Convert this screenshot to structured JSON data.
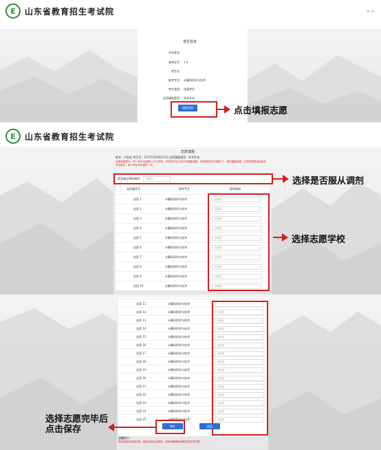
{
  "site_title": "山东省教育招生考试院",
  "header_right": "≡ ∨",
  "panel1": {
    "title": "考生信息",
    "fields": [
      {
        "label": "学生姓名：",
        "value": ""
      },
      {
        "label": "准考证号：",
        "value": "1                    9"
      },
      {
        "label": "考生号：",
        "value": ""
      },
      {
        "label": "报考专业：",
        "value": "计算机科学与技术"
      },
      {
        "label": "考生类型：",
        "value": "往届考生"
      },
      {
        "label": "志愿填报类型：",
        "value": "非专升本"
      }
    ],
    "fill_button": "填报志愿",
    "annotation": "点击填报志愿"
  },
  "panel2": {
    "title": "志愿填报",
    "info": "姓名：卢金宏    考生号：22371501822722    志愿填报类型：非专升本",
    "warning": "志愿填报提示：同一专业可选择1-20个学校，不同的专业之间不可重复填报，专科院校仅可填报1个，请勿重复填报，注意院校是否招收本专业考生，每个考生仅可提交一次。",
    "adjust_label": "是否服从院校调剂：",
    "adjust_placeholder": "请选择",
    "annotation_adjust": "选择是否服从调剂",
    "annotation_school": "选择志愿学校",
    "col_headers": [
      "志愿顺序号",
      "报考专业",
      "报考院校"
    ],
    "rows": [
      {
        "order": "志愿 1",
        "major": "计算机科学与技术",
        "school": "请选择"
      },
      {
        "order": "志愿 2",
        "major": "计算机科学与技术",
        "school": "请选择"
      },
      {
        "order": "志愿 3",
        "major": "计算机科学与技术",
        "school": "请选择"
      },
      {
        "order": "志愿 4",
        "major": "计算机科学与技术",
        "school": "请选择"
      },
      {
        "order": "志愿 5",
        "major": "计算机科学与技术",
        "school": "请选择"
      },
      {
        "order": "志愿 6",
        "major": "计算机科学与技术",
        "school": "请选择"
      },
      {
        "order": "志愿 7",
        "major": "计算机科学与技术",
        "school": "请选择"
      },
      {
        "order": "志愿 8",
        "major": "计算机科学与技术",
        "school": "请选择"
      },
      {
        "order": "志愿 9",
        "major": "计算机科学与技术",
        "school": "请选择"
      },
      {
        "order": "志愿 10",
        "major": "计算机科学与技术",
        "school": "请选择"
      }
    ]
  },
  "panel3": {
    "rows": [
      {
        "order": "志愿 11",
        "major": "计算机科学与技术",
        "school": ""
      },
      {
        "order": "志愿 12",
        "major": "计算机科学与技术",
        "school": "请选择"
      },
      {
        "order": "志愿 13",
        "major": "计算机科学与技术",
        "school": "请选择"
      },
      {
        "order": "志愿 14",
        "major": "计算机科学与技术",
        "school": "请选择"
      },
      {
        "order": "志愿 15",
        "major": "计算机科学与技术",
        "school": "请选择"
      },
      {
        "order": "志愿 16",
        "major": "计算机科学与技术",
        "school": "请选择"
      },
      {
        "order": "志愿 17",
        "major": "计算机科学与技术",
        "school": "请选择"
      },
      {
        "order": "志愿 18",
        "major": "计算机科学与技术",
        "school": "请选择"
      },
      {
        "order": "志愿 19",
        "major": "计算机科学与技术",
        "school": "请选择"
      },
      {
        "order": "志愿 20",
        "major": "计算机科学与技术",
        "school": "请选择"
      },
      {
        "order": "志愿 21",
        "major": "计算机科学与技术",
        "school": "请选择"
      },
      {
        "order": "志愿 22",
        "major": "计算机科学与技术",
        "school": "请选择"
      },
      {
        "order": "志愿 23",
        "major": "计算机科学与技术",
        "school": "请选择"
      },
      {
        "order": "志愿 24",
        "major": "计算机科学与技术",
        "school": "请选择"
      },
      {
        "order": "志愿 25",
        "major": "计算机科学与技术",
        "school": "请选择"
      }
    ],
    "save_button": "保存",
    "back_button": "返回",
    "note_title": "温馨提示：",
    "note_text": "请认真核对志愿信息，保存后将无法修改，如有问题请及时联系招生考试院。",
    "annotation_save_line1": "选择志愿完毕后",
    "annotation_save_line2": "点击保存"
  }
}
